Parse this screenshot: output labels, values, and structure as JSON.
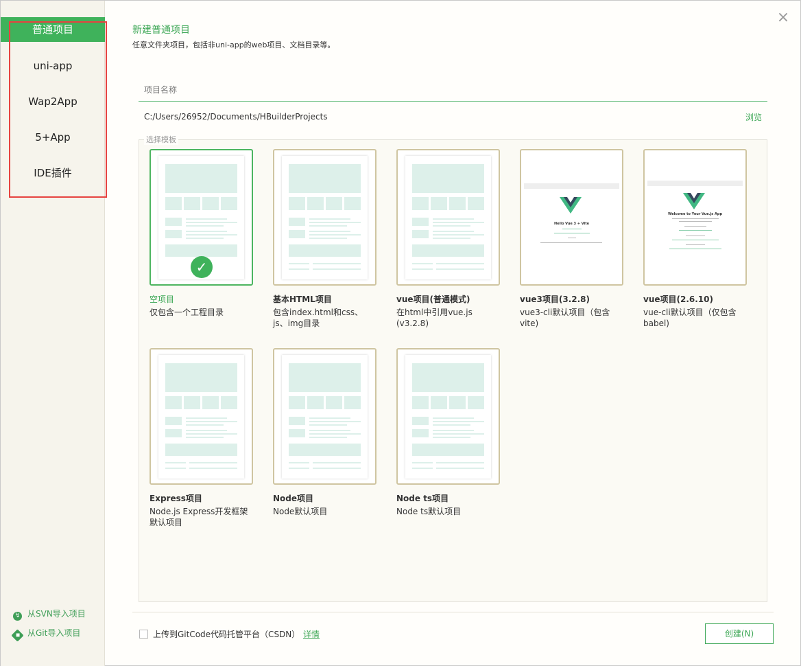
{
  "sidebar": {
    "items": [
      {
        "label": "普通项目"
      },
      {
        "label": "uni-app"
      },
      {
        "label": "Wap2App"
      },
      {
        "label": "5+App"
      },
      {
        "label": "IDE插件"
      }
    ],
    "links": [
      {
        "label": "从SVN导入项目",
        "icon": "svn-icon"
      },
      {
        "label": "从Git导入项目",
        "icon": "git-icon"
      }
    ]
  },
  "dialog": {
    "close_symbol": "×",
    "title": "新建普通项目",
    "subtitle": "任意文件夹项目，包括非uni-app的web项目、文档目录等。"
  },
  "form": {
    "name_placeholder": "项目名称",
    "path": "C:/Users/26952/Documents/HBuilderProjects",
    "browse_label": "浏览",
    "template_legend": "选择模板"
  },
  "templates": [
    {
      "title": "空项目",
      "desc": "仅包含一个工程目录",
      "selected": true
    },
    {
      "title": "基本HTML项目",
      "desc": "包含index.html和css、js、img目录"
    },
    {
      "title": "vue项目(普通模式)",
      "desc": "在html中引用vue.js (v3.2.8)"
    },
    {
      "title": "vue3项目(3.2.8)",
      "desc": "vue3-cli默认项目（包含vite)",
      "screenshot_title": "Hello Vue 3 + Vite"
    },
    {
      "title": "vue项目(2.6.10)",
      "desc": "vue-cli默认项目（仅包含babel)",
      "screenshot_title": "Welcome to Your Vue.js App"
    },
    {
      "title": "Express项目",
      "desc": "Node.js Express开发框架默认项目"
    },
    {
      "title": "Node项目",
      "desc": "Node默认项目"
    },
    {
      "title": "Node ts项目",
      "desc": "Node ts默认项目"
    }
  ],
  "footer": {
    "upload_label": "上传到GitCode代码托管平台（CSDN）",
    "details_label": "详情",
    "create_label": "创建(N)"
  },
  "colors": {
    "accent": "#3fb25b",
    "sidebar_bg": "#f6f4ec",
    "highlight_outline": "#e64340"
  }
}
